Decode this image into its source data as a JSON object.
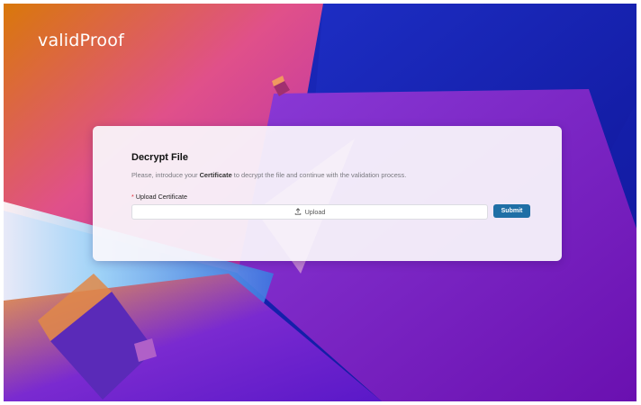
{
  "brand": {
    "logo_text": "validProof"
  },
  "dialog": {
    "title": "Decrypt File",
    "description_pre": "Please, introduce your ",
    "description_bold": "Certificate",
    "description_post": " to decrypt the file and continue with the  validation process.",
    "field_required_mark": "*",
    "field_label": "Upload Certificate",
    "upload_label": "Upload",
    "upload_icon": "upload-icon",
    "submit_label": "Submit"
  },
  "colors": {
    "accent": "#1f6fa6",
    "required": "#e0303a"
  }
}
